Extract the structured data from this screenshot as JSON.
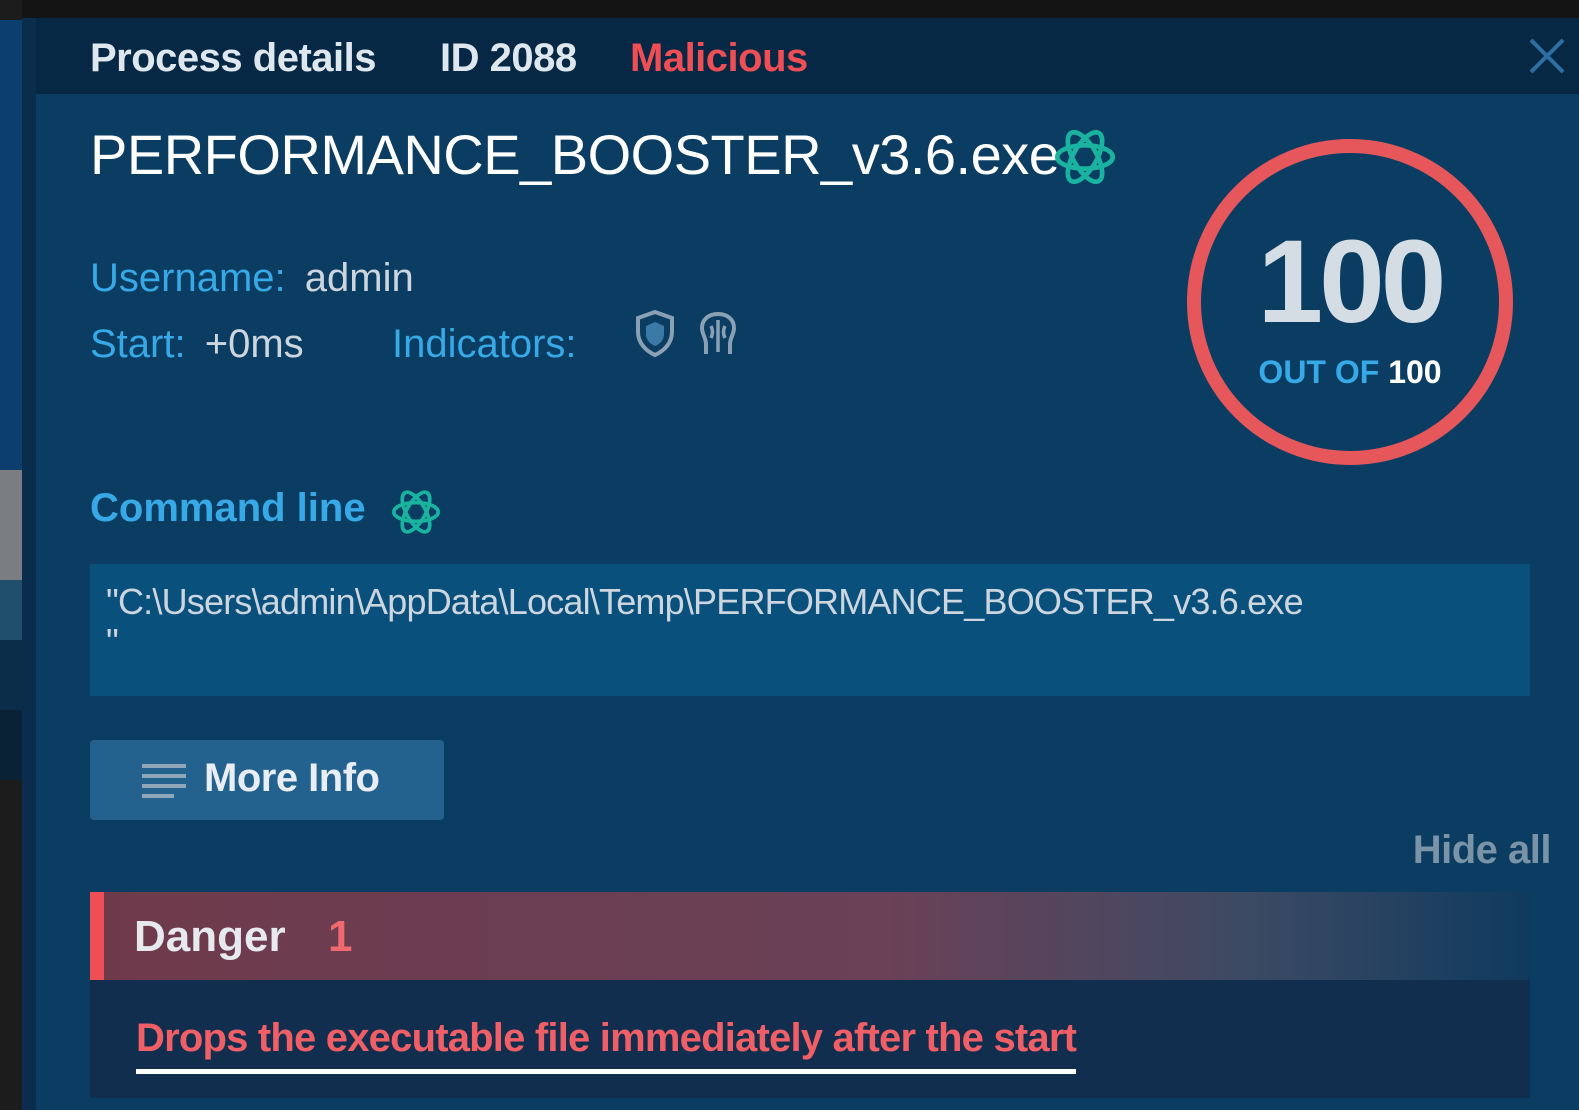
{
  "header": {
    "title": "Process details",
    "id": "ID 2088",
    "status": "Malicious"
  },
  "process": {
    "name": "PERFORMANCE_BOOSTER_v3.6.exe",
    "username_label": "Username:",
    "username": "admin",
    "start_label": "Start:",
    "start": "+0ms",
    "indicators_label": "Indicators:",
    "indicators": [
      "shield-icon",
      "brain-icon"
    ]
  },
  "score": {
    "value": "100",
    "out_of_label": "OUT OF",
    "max": "100"
  },
  "command_line": {
    "title": "Command line",
    "text": "\"C:\\Users\\admin\\AppData\\Local\\Temp\\PERFORMANCE_BOOSTER_v3.6.exe\n\""
  },
  "buttons": {
    "more_info": "More Info",
    "hide_all": "Hide all"
  },
  "danger": {
    "label": "Danger",
    "count": "1",
    "items": [
      "Drops the executable file immediately after the start"
    ]
  },
  "colors": {
    "malicious": "#ef4e55",
    "label_blue": "#36a9e6",
    "ai_icon": "#19b3a0",
    "score_ring": "#e5575b"
  }
}
